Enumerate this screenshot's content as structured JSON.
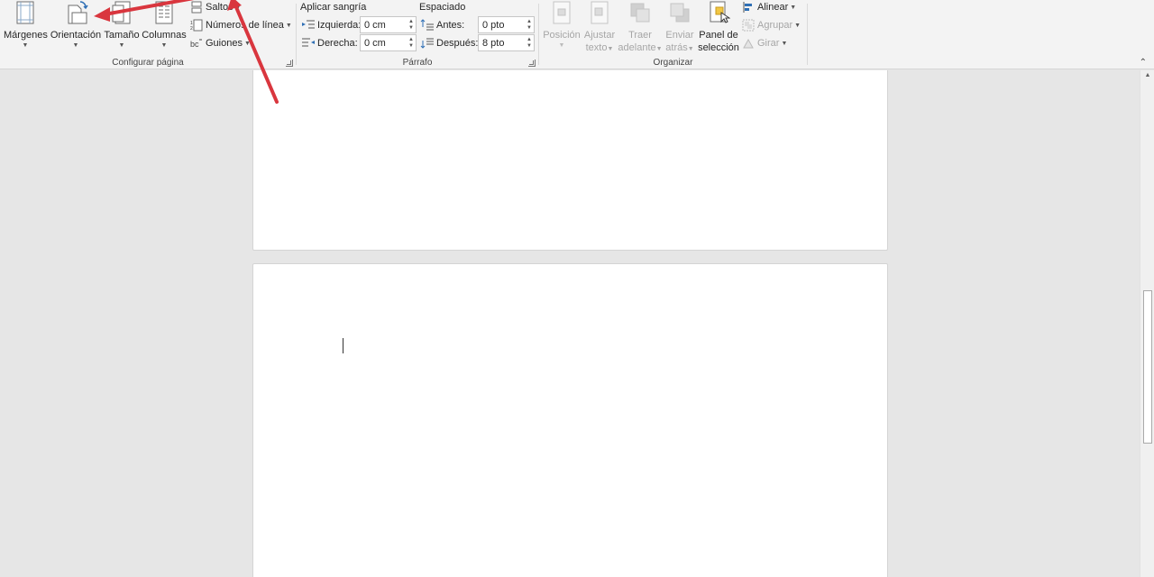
{
  "ribbon": {
    "page_setup": {
      "group_label": "Configurar página",
      "margins_label": "Márgenes",
      "orientation_label": "Orientación",
      "size_label": "Tamaño",
      "columns_label": "Columnas",
      "breaks_label": "Saltos",
      "line_numbers_label": "Números de línea",
      "hyphenation_label": "Guiones"
    },
    "paragraph": {
      "group_label": "Párrafo",
      "indent_header": "Aplicar sangría",
      "spacing_header": "Espaciado",
      "left_label": "Izquierda:",
      "left_value": "0 cm",
      "right_label": "Derecha:",
      "right_value": "0 cm",
      "before_label": "Antes:",
      "before_value": "0 pto",
      "after_label": "Después:",
      "after_value": "8 pto"
    },
    "arrange": {
      "group_label": "Organizar",
      "position_label": "Posición",
      "wrap_text_label_1": "Ajustar",
      "wrap_text_label_2": "texto",
      "bring_forward_label_1": "Traer",
      "bring_forward_label_2": "adelante",
      "send_backward_label_1": "Enviar",
      "send_backward_label_2": "atrás",
      "selection_pane_label_1": "Panel de",
      "selection_pane_label_2": "selección",
      "align_label": "Alinear",
      "group_obj_label": "Agrupar",
      "rotate_label": "Girar"
    }
  },
  "colors": {
    "annotation_arrow": "#d9363e",
    "ribbon_bg": "#f3f3f3",
    "doc_bg": "#e6e6e6"
  }
}
